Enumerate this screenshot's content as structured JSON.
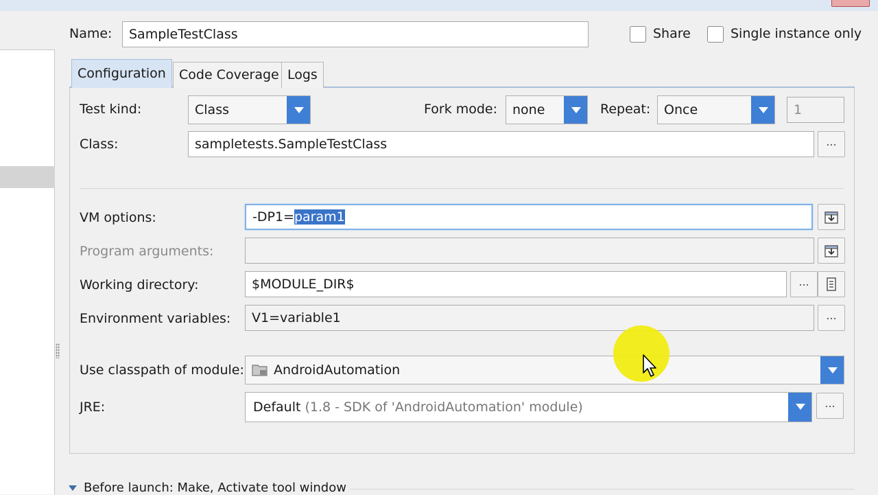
{
  "header": {
    "name_label": "Name:",
    "name_value": "SampleTestClass",
    "share_label": "Share",
    "single_instance_label": "Single instance only"
  },
  "tabs": [
    {
      "label": "Configuration"
    },
    {
      "label": "Code Coverage"
    },
    {
      "label": "Logs"
    }
  ],
  "config": {
    "test_kind_label": "Test kind:",
    "test_kind_value": "Class",
    "fork_mode_label": "Fork mode:",
    "fork_mode_value": "none",
    "repeat_label": "Repeat:",
    "repeat_value": "Once",
    "repeat_count": "1",
    "class_label": "Class:",
    "class_value": "sampletests.SampleTestClass",
    "vm_options_label": "VM options:",
    "vm_options_prefix": "-DP1=",
    "vm_options_selected": "param1",
    "program_args_label": "Program arguments:",
    "program_args_value": "",
    "working_dir_label": "Working directory:",
    "working_dir_value": "$MODULE_DIR$",
    "env_vars_label": "Environment variables:",
    "env_vars_value": "V1=variable1",
    "classpath_label": "Use classpath of module:",
    "classpath_value": "AndroidAutomation",
    "jre_label": "JRE:",
    "jre_value_main": "Default",
    "jre_value_detail": "(1.8 - SDK of 'AndroidAutomation' module)",
    "ellipsis": "..."
  },
  "footer": {
    "before_launch": "Before launch: Make, Activate tool window"
  },
  "icons": [
    "checkbox-icon",
    "dropdown-arrow-icon",
    "insert-icon",
    "folder-icon",
    "module-folder-icon",
    "mouse-pointer-icon"
  ],
  "colors": {
    "accent": "#3f7fd6",
    "selection": "#3a74c9",
    "cursor_highlight": "#f1ec12"
  }
}
